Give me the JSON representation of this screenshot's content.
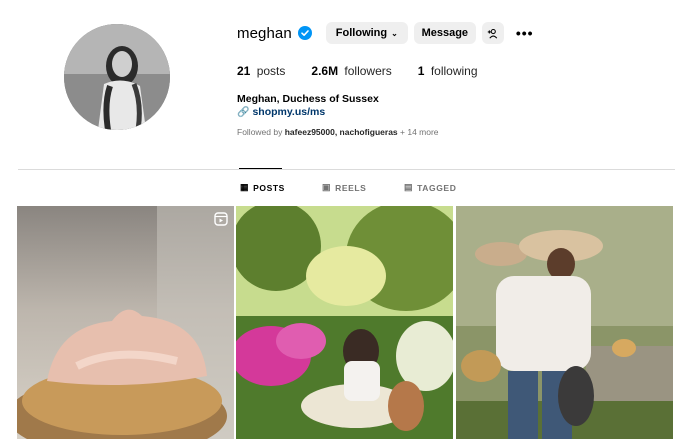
{
  "profile": {
    "username": "meghan",
    "following_label": "Following",
    "message_label": "Message",
    "posts_count": "21",
    "posts_label": "posts",
    "followers_count": "2.6M",
    "followers_label": "followers",
    "following_count": "1",
    "following_stat_label": "following",
    "full_name": "Meghan, Duchess of Sussex",
    "link": "shopmy.us/ms",
    "followed_by_prefix": "Followed by",
    "followed_by_users": "hafeez95000, nachofigueras",
    "followed_by_more": "+ 14 more"
  },
  "tabs": {
    "posts": "POSTS",
    "reels": "REELS",
    "tagged": "TAGGED"
  },
  "colors": {
    "verified": "#0095f6",
    "link": "#00376b",
    "button_bg": "#efefef",
    "divider": "#dbdbdb"
  },
  "icons": [
    "verified-badge-icon",
    "chevron-down-icon",
    "add-user-icon",
    "more-options-icon",
    "link-icon",
    "grid-icon",
    "reels-icon",
    "tagged-icon",
    "reel-badge-icon"
  ]
}
